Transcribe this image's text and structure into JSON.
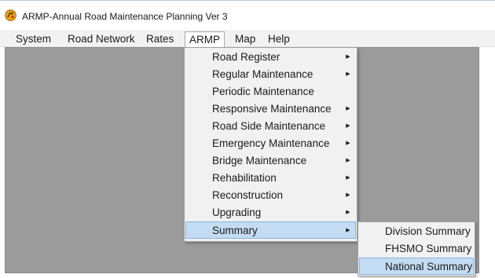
{
  "window": {
    "title": "ARMP-Annual Road Maintenance Planning Ver 3",
    "icon": "app-logo-icon"
  },
  "menubar": [
    {
      "label": "System"
    },
    {
      "label": "Road Network"
    },
    {
      "label": "Rates"
    },
    {
      "label": "ARMP",
      "active": true
    },
    {
      "label": "Map"
    },
    {
      "label": "Help"
    }
  ],
  "armp_menu": [
    {
      "label": "Road Register",
      "has_submenu": true
    },
    {
      "label": "Regular Maintenance",
      "has_submenu": true
    },
    {
      "label": "Periodic Maintenance",
      "has_submenu": false
    },
    {
      "label": "Responsive Maintenance",
      "has_submenu": true
    },
    {
      "label": "Road Side Maintenance",
      "has_submenu": true
    },
    {
      "label": "Emergency Maintenance",
      "has_submenu": true
    },
    {
      "label": "Bridge Maintenance",
      "has_submenu": true
    },
    {
      "label": "Rehabilitation",
      "has_submenu": true
    },
    {
      "label": "Reconstruction",
      "has_submenu": true
    },
    {
      "label": "Upgrading",
      "has_submenu": true
    },
    {
      "label": "Summary",
      "has_submenu": true,
      "highlighted": true
    }
  ],
  "summary_submenu": [
    {
      "label": "Division Summary"
    },
    {
      "label": "FHSMO Summary"
    },
    {
      "label": "National Summary",
      "highlighted": true
    }
  ],
  "colors": {
    "workspace": "#9b9b9b",
    "menu_background": "#f1f1f1",
    "highlight": "#c4dcf3",
    "highlight_border": "#88b4e0"
  }
}
